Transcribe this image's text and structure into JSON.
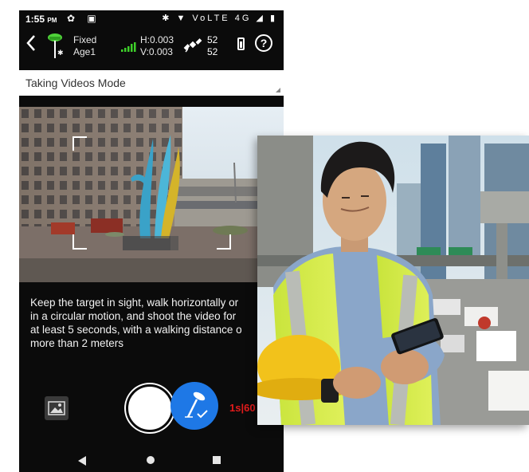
{
  "status_bar": {
    "time": "1:55",
    "ampm": "PM",
    "left_icons": "✿ ▣",
    "right_icons": "✱ ▼ VoLTE 4G ◢ ▮"
  },
  "top_bar": {
    "back_icon": "chevron-left-icon",
    "fix_status": "Fixed",
    "age": "Age1",
    "h_precision": "H:0.003",
    "v_precision": "V:0.003",
    "satellites_tracked": "52",
    "satellites_used": "52",
    "help_label": "?"
  },
  "mode_select": {
    "value": "Taking Videos Mode"
  },
  "instructions": {
    "line1": "Keep the target in sight, walk horizontally or",
    "line2": "in a circular motion, and shoot the video for",
    "line3": "at least 5 seconds, with a walking distance o",
    "line4": "more than 2 meters"
  },
  "controls": {
    "timer": "1s|60"
  },
  "colors": {
    "accent_blue": "#1e78e6",
    "timer_red": "#e21b1b",
    "signal_green": "#3ecf2a",
    "antenna_green": "#4fd23a"
  }
}
